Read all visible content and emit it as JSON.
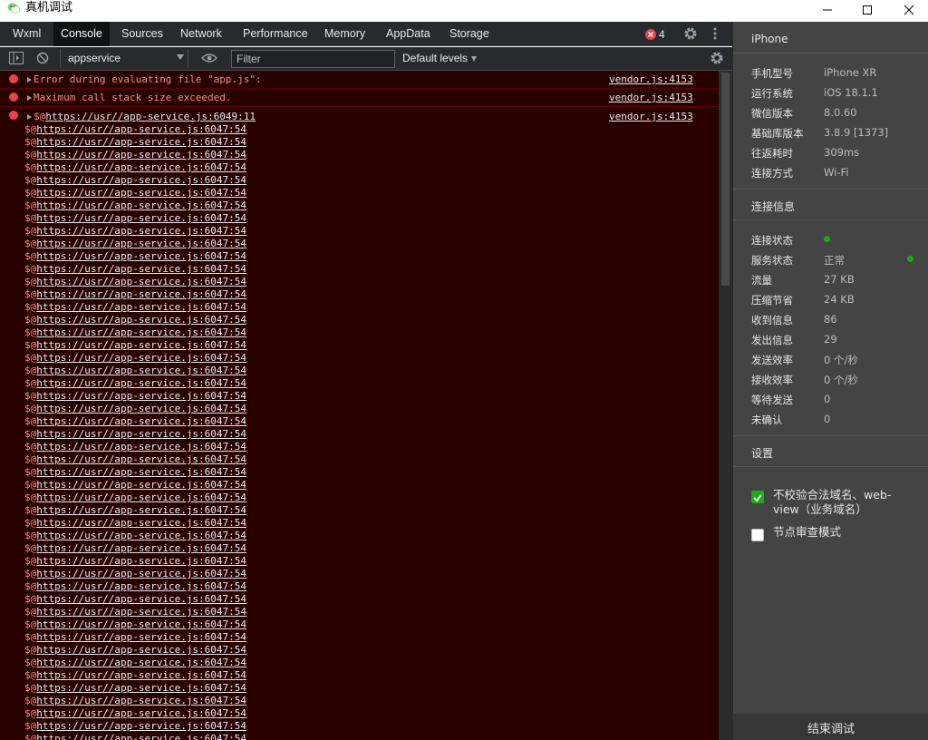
{
  "window": {
    "title": "真机调试"
  },
  "tabs": [
    "Wxml",
    "Console",
    "Sources",
    "Network",
    "Performance",
    "Memory",
    "AppData",
    "Storage"
  ],
  "error_count": "4",
  "toolbar": {
    "context": "appservice",
    "filter_placeholder": "Filter",
    "levels": "Default levels"
  },
  "messages": [
    {
      "text": "Error during evaluating file \"app.js\":",
      "source": "vendor.js:4153"
    },
    {
      "text": "Maximum call stack size exceeded.",
      "source": "vendor.js:4153"
    }
  ],
  "stack": {
    "prefix": "$@",
    "head_link": "https://usr//app-service.js:6049:11",
    "source": "vendor.js:4153",
    "frame_prefix": "$@",
    "frame_link": "https://usr//app-service.js:6047:54",
    "frame_count": 49
  },
  "panel": {
    "device_title": "iPhone",
    "device_rows": [
      {
        "label": "手机型号",
        "value": "iPhone XR"
      },
      {
        "label": "运行系统",
        "value": "iOS 18.1.1"
      },
      {
        "label": "微信版本",
        "value": "8.0.60"
      },
      {
        "label": "基础库版本",
        "value": "3.8.9 [1373]"
      },
      {
        "label": "往返耗时",
        "value": "309ms"
      },
      {
        "label": "连接方式",
        "value": "Wi-Fi"
      }
    ],
    "conn_title": "连接信息",
    "conn_rows": [
      {
        "label": "连接状态",
        "value": ""
      },
      {
        "label": "服务状态",
        "value": "正常"
      },
      {
        "label": "流量",
        "value": "27 KB"
      },
      {
        "label": "压缩节省",
        "value": "24 KB"
      },
      {
        "label": "收到信息",
        "value": "86"
      },
      {
        "label": "发出信息",
        "value": "29"
      },
      {
        "label": "发送效率",
        "value": "0 个/秒"
      },
      {
        "label": "接收效率",
        "value": "0 个/秒"
      },
      {
        "label": "等待发送",
        "value": "0"
      },
      {
        "label": "未确认",
        "value": "0"
      }
    ],
    "settings_title": "设置",
    "checkbox1": {
      "label": "不校验合法域名、web-view（业务域名）",
      "checked": true
    },
    "checkbox2": {
      "label": "节点审查模式",
      "checked": false
    },
    "end_button": "结束调试"
  },
  "colors": {
    "console_bg": "#290000",
    "error_text": "#f28b82",
    "status_green": "#1aad19",
    "panel_bg": "#444444"
  }
}
